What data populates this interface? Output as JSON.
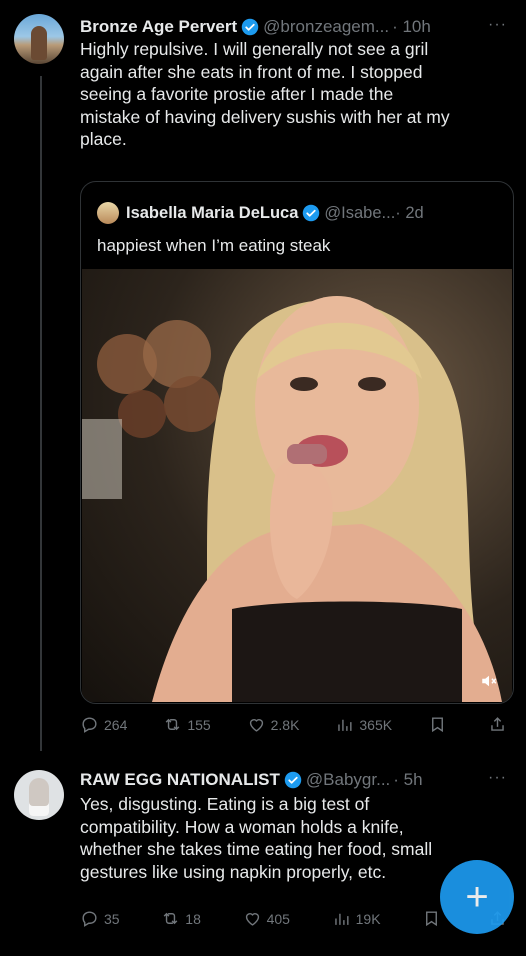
{
  "tweet1": {
    "name": "Bronze Age Pervert",
    "handle": "@bronzeagem...",
    "time": "· 10h",
    "more": "···",
    "lines": [
      "Highly repulsive. I will generally not see a gril",
      "again after she eats in front of me. I stopped",
      "seeing a favorite prostie after I made the",
      "mistake of having delivery sushis with her at my",
      "place."
    ],
    "actions": {
      "reply": "264",
      "repost": "155",
      "like": "2.8K",
      "views": "365K"
    }
  },
  "quote": {
    "name": "Isabella Maria DeLuca",
    "handle": "@Isabe...",
    "time": "· 2d",
    "text": "happiest when I’m eating steak"
  },
  "tweet2": {
    "name": "RAW EGG NATIONALIST",
    "handle": "@Babygr...",
    "time": "· 5h",
    "more": "···",
    "lines": [
      "Yes, disgusting. Eating is a big test of",
      "compatibility. How a woman holds a knife,",
      "whether she takes time eating her food, small",
      "gestures like using napkin properly, etc."
    ],
    "actions": {
      "reply": "35",
      "repost": "18",
      "like": "405",
      "views": "19K"
    }
  },
  "fab": {
    "label": "+"
  },
  "colors": {
    "verified": "#1d9bf0",
    "muted": "#71767b",
    "fab": "#1d9bf0"
  }
}
